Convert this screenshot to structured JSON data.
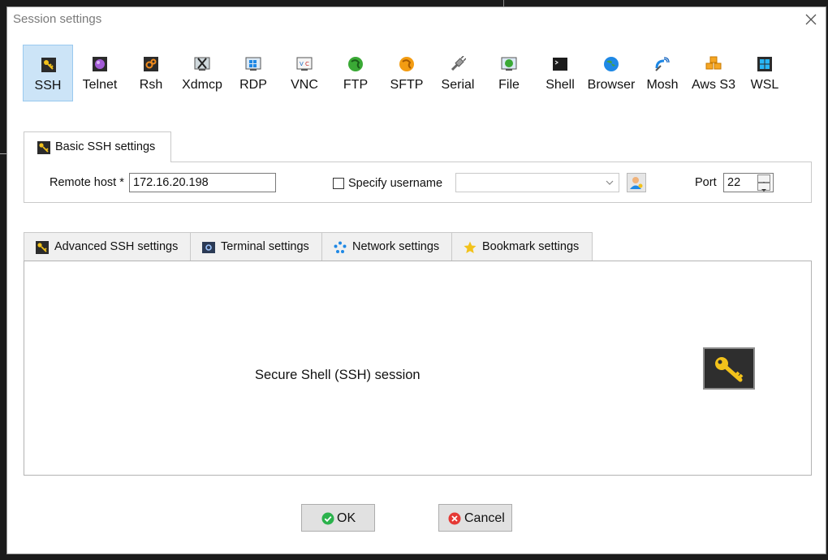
{
  "dialog": {
    "title": "Session settings"
  },
  "session_types": [
    {
      "label": "SSH",
      "icon": "ssh-key-icon",
      "selected": true
    },
    {
      "label": "Telnet",
      "icon": "telnet-icon"
    },
    {
      "label": "Rsh",
      "icon": "rsh-icon"
    },
    {
      "label": "Xdmcp",
      "icon": "xdmcp-icon"
    },
    {
      "label": "RDP",
      "icon": "rdp-icon"
    },
    {
      "label": "VNC",
      "icon": "vnc-icon"
    },
    {
      "label": "FTP",
      "icon": "ftp-icon"
    },
    {
      "label": "SFTP",
      "icon": "sftp-icon"
    },
    {
      "label": "Serial",
      "icon": "serial-icon"
    },
    {
      "label": "File",
      "icon": "file-icon"
    },
    {
      "label": "Shell",
      "icon": "shell-icon"
    },
    {
      "label": "Browser",
      "icon": "browser-icon"
    },
    {
      "label": "Mosh",
      "icon": "mosh-icon"
    },
    {
      "label": "Aws S3",
      "icon": "aws-s3-icon"
    },
    {
      "label": "WSL",
      "icon": "wsl-icon"
    }
  ],
  "basic_tab": {
    "label": "Basic SSH settings"
  },
  "basic": {
    "remote_host_label": "Remote host *",
    "remote_host_value": "172.16.20.198",
    "specify_username_label": "Specify username",
    "specify_username_checked": false,
    "username_value": "",
    "port_label": "Port",
    "port_value": "22"
  },
  "lower_tabs": {
    "advanced": "Advanced SSH settings",
    "terminal": "Terminal settings",
    "network": "Network settings",
    "bookmark": "Bookmark settings"
  },
  "panel": {
    "description": "Secure Shell (SSH) session"
  },
  "buttons": {
    "ok": "OK",
    "cancel": "Cancel"
  },
  "colors": {
    "selected_bg": "#cce4f7",
    "ok_green": "#2bb24c",
    "cancel_red": "#e53935",
    "key_yellow": "#f2c21b"
  }
}
